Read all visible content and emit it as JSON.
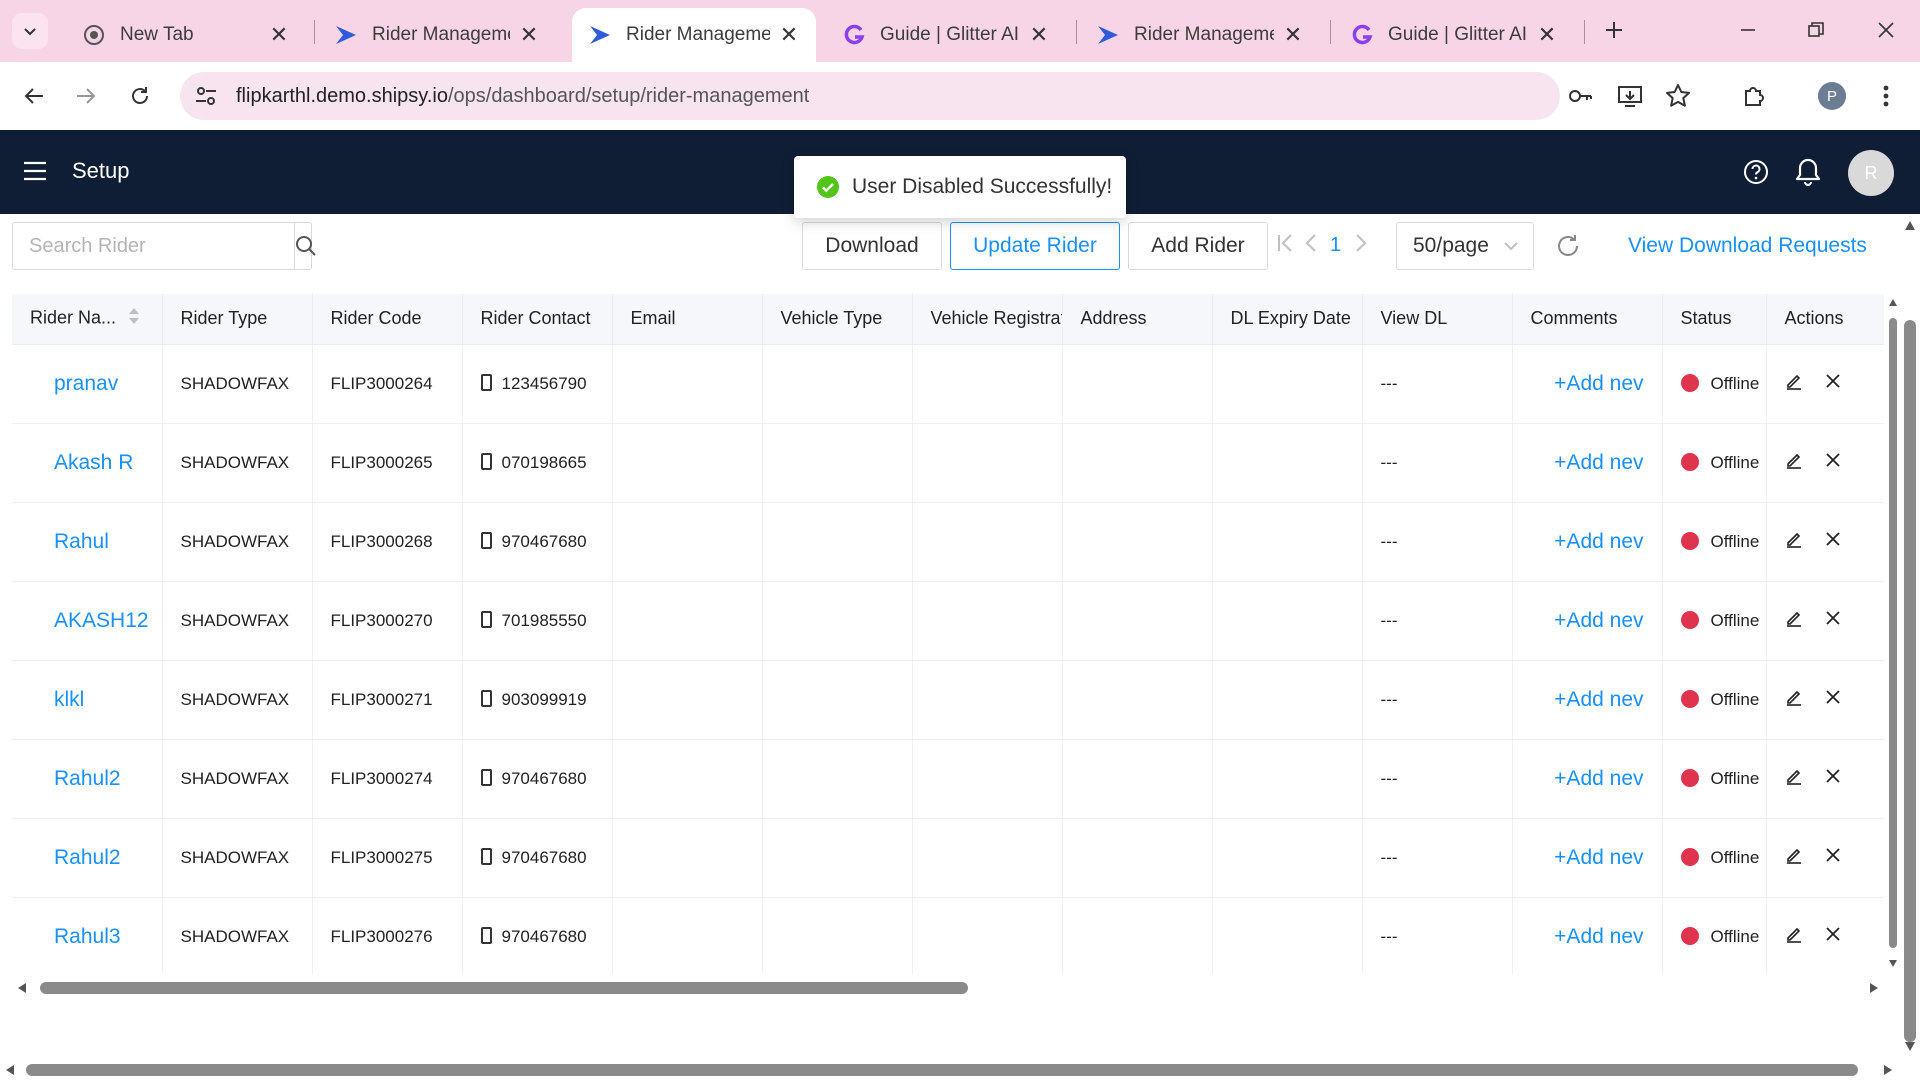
{
  "browser": {
    "tabs": [
      {
        "title": "New Tab",
        "favicon": "chrome-icon",
        "active": false
      },
      {
        "title": "Rider Management",
        "favicon": "shipsy-icon",
        "active": false
      },
      {
        "title": "Rider Management",
        "favicon": "shipsy-icon",
        "active": true
      },
      {
        "title": "Guide | Glitter AI",
        "favicon": "glitter-icon",
        "active": false
      },
      {
        "title": "Rider Management",
        "favicon": "shipsy-icon",
        "active": false
      },
      {
        "title": "Guide | Glitter AI",
        "favicon": "glitter-icon",
        "active": false
      }
    ],
    "url_domain": "flipkarthl.demo.shipsy.io",
    "url_path": "/ops/dashboard/setup/rider-management",
    "profile_initial": "P"
  },
  "header": {
    "title": "Setup",
    "user_initial": "R"
  },
  "toast": {
    "message": "User Disabled Successfully!"
  },
  "toolbar": {
    "search_placeholder": "Search Rider",
    "download_label": "Download",
    "update_label": "Update Rider",
    "add_label": "Add Rider",
    "page_number": "1",
    "page_size": "50/page",
    "view_download_requests": "View Download Requests"
  },
  "table": {
    "columns": [
      "Rider Na...",
      "Rider Type",
      "Rider Code",
      "Rider Contact",
      "Email",
      "Vehicle Type",
      "Vehicle Registrat",
      "Address",
      "DL Expiry Date",
      "View DL",
      "Comments",
      "Status",
      "Actions"
    ],
    "rows": [
      {
        "name": "pranav",
        "type": "SHADOWFAX",
        "code": "FLIP3000264",
        "contact": "123456790",
        "view_dl": "---",
        "comment": "+Add nev",
        "status": "Offline"
      },
      {
        "name": "Akash R",
        "type": "SHADOWFAX",
        "code": "FLIP3000265",
        "contact": "070198665",
        "view_dl": "---",
        "comment": "+Add nev",
        "status": "Offline"
      },
      {
        "name": "Rahul",
        "type": "SHADOWFAX",
        "code": "FLIP3000268",
        "contact": "970467680",
        "view_dl": "---",
        "comment": "+Add nev",
        "status": "Offline"
      },
      {
        "name": "AKASH12",
        "type": "SHADOWFAX",
        "code": "FLIP3000270",
        "contact": "701985550",
        "view_dl": "---",
        "comment": "+Add nev",
        "status": "Offline"
      },
      {
        "name": "klkl",
        "type": "SHADOWFAX",
        "code": "FLIP3000271",
        "contact": "903099919",
        "view_dl": "---",
        "comment": "+Add nev",
        "status": "Offline"
      },
      {
        "name": "Rahul2",
        "type": "SHADOWFAX",
        "code": "FLIP3000274",
        "contact": "970467680",
        "view_dl": "---",
        "comment": "+Add nev",
        "status": "Offline"
      },
      {
        "name": "Rahul2",
        "type": "SHADOWFAX",
        "code": "FLIP3000275",
        "contact": "970467680",
        "view_dl": "---",
        "comment": "+Add nev",
        "status": "Offline"
      },
      {
        "name": "Rahul3",
        "type": "SHADOWFAX",
        "code": "FLIP3000276",
        "contact": "970467680",
        "view_dl": "---",
        "comment": "+Add nev",
        "status": "Offline"
      }
    ]
  },
  "colors": {
    "accent": "#1890ff",
    "header_bg": "#0f1e35",
    "status_offline": "#e0344e",
    "tabbar_bg": "#f8d5e6",
    "toast_success": "#52c41a"
  }
}
